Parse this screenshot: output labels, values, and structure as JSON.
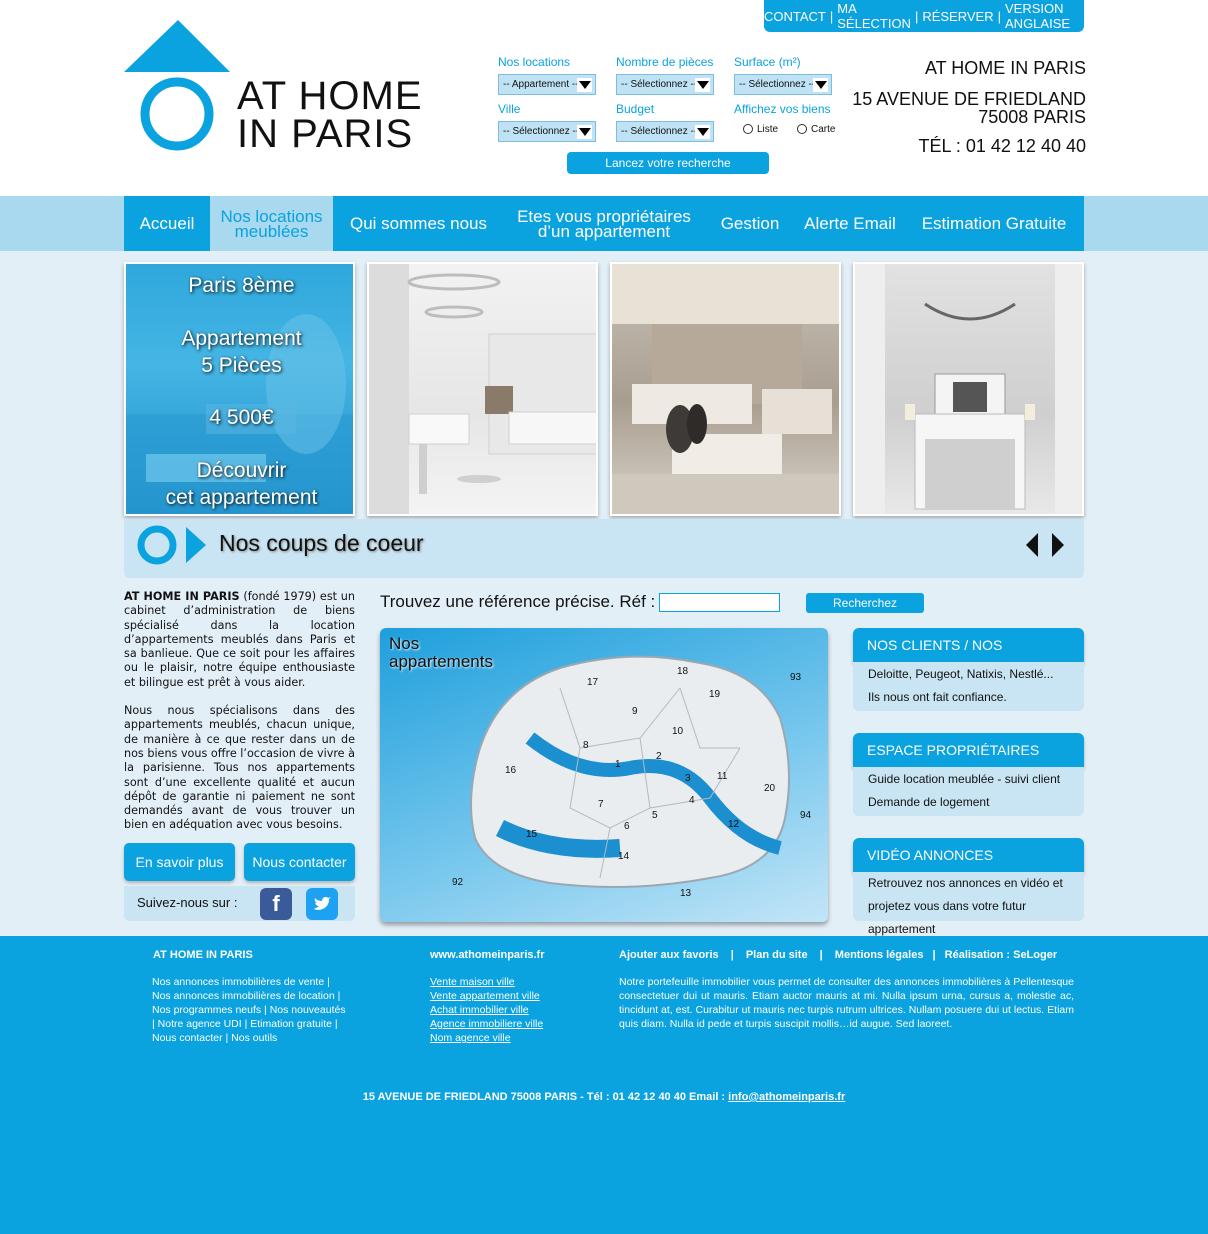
{
  "top_links": [
    "CONTACT",
    "MA SÉLECTION",
    "RÉSERVER",
    "VERSION ANGLAISE"
  ],
  "logo": {
    "line1": "AT HOME",
    "line2": "IN PARIS"
  },
  "search": {
    "nos_locations_label": "Nos locations",
    "nos_locations_value": "-- Appartement --",
    "pieces_label": "Nombre de pièces",
    "pieces_value": "-- Sélectionnez --",
    "surface_label": "Surface (m²)",
    "surface_value": "-- Sélectionnez --",
    "ville_label": "Ville",
    "ville_value": "-- Sélectionnez --",
    "budget_label": "Budget",
    "budget_value": "-- Sélectionnez --",
    "affichez_label": "Affichez vos biens",
    "radio_liste": "Liste",
    "radio_carte": "Carte",
    "launch": "Lancez votre recherche"
  },
  "contact": {
    "name": "AT HOME IN PARIS",
    "address1": "15 AVENUE DE FRIEDLAND",
    "address2": "75008 PARIS",
    "phone": "TÉL : 01 42 12 40 40"
  },
  "nav": [
    {
      "label": "Accueil"
    },
    {
      "label": "Nos locations meublées"
    },
    {
      "label": "Qui sommes nous"
    },
    {
      "label": "Etes vous propriétaires d’un appartement"
    },
    {
      "label": "Gestion"
    },
    {
      "label": "Alerte Email"
    },
    {
      "label": "Estimation Gratuite"
    }
  ],
  "feature": {
    "area": "Paris 8ème",
    "type1": "Appartement",
    "type2": "5 Pièces",
    "price": "4 500€",
    "cta1": "Découvrir",
    "cta2": "cet appartement"
  },
  "coups_de_coeur": "Nos coups de coeur",
  "about": {
    "brand": "AT HOME IN PARIS",
    "p1": " (fondé 1979) est un cabinet d’administration de biens spécialisé dans la location d’appartements meublés dans Paris et sa banlieue. Que ce soit pour les affaires ou le plaisir, notre équipe enthousiaste et bilingue est prêt à vous aider.",
    "p2": "Nous nous spécialisons dans des appartements meublés, chacun unique, de manière à ce que rester dans un de nos biens vous offre l’occasion de vivre à la parisienne. Tous nos appartements sont d’une excellente qualité et aucun dépôt de garantie ni paiement ne sont demandés avant de vous trouver un bien en adéquation avec vous besoins."
  },
  "buttons": {
    "savoir_plus": "En savoir plus",
    "nous_contacter": "Nous contacter",
    "suivez": "Suivez-nous sur :"
  },
  "ref": {
    "label": "Trouvez une référence précise.  Réf :",
    "button": "Recherchez"
  },
  "map": {
    "title1": "Nos",
    "title2": "appartements",
    "arrondissements": [
      "17",
      "18",
      "19",
      "93",
      "8",
      "9",
      "10",
      "16",
      "2",
      "3",
      "11",
      "1",
      "4",
      "20",
      "7",
      "6",
      "5",
      "15",
      "12",
      "94",
      "14",
      "13",
      "92"
    ]
  },
  "panels": {
    "clients": {
      "title": "NOS CLIENTS / NOS PARTENAIRES",
      "lines": [
        "Deloitte, Peugeot, Natixis, Nestlé...",
        "Ils nous ont fait confiance."
      ]
    },
    "proprietaires": {
      "title": "ESPACE PROPRIÉTAIRES",
      "lines": [
        "Guide location meublée - suivi client",
        "Demande de logement"
      ]
    },
    "video": {
      "title": "VIDÉO ANNONCES",
      "lines": [
        "Retrouvez nos annonces en vidéo et",
        "projetez vous dans votre futur appartement"
      ]
    }
  },
  "footer": {
    "col1_title": "AT HOME IN PARIS",
    "col1_lines": [
      "Nos annonces immobilières de vente |",
      "Nos annonces immobilières de location |",
      "Nos programmes neufs | Nos nouveautés",
      "| Notre agence UDI | Etimation gratuite |",
      "Nous contacter | Nos outils"
    ],
    "col2_title": "www.athomeinparis.fr",
    "col2_links": [
      "Vente maison ville",
      "Vente appartement ville",
      "Achat immobilier ville",
      "Agence immobiliere ville",
      "Nom agence ville"
    ],
    "col3_links": [
      "Ajouter aux favoris",
      "Plan du site",
      "Mentions légales",
      "Réalisation : SeLoger"
    ],
    "col3_text": "Notre portefeuille immobilier vous permet de consulter des annonces immobilières à Pellentesque consectetuer dui ut mauris. Etiam auctor mauris at mi. Nulla ipsum urna, cursus a, molestie ac, tincidunt at, est. Curabitur ut mauris nec turpis rutrum ultrices. Nullam posuere dui ut lectus. Etiam quis diam. Nulla id pede et turpis suscipit mollis…id augue. Sed laoreet.",
    "bottom_address": "15 AVENUE DE FRIEDLAND 75008 PARIS  -  Tél : 01 42 12 40 40  Email : ",
    "bottom_email": "info@athomeinparis.fr"
  },
  "colors": {
    "accent": "#0aa2df",
    "light": "#a8d9ef",
    "panel": "#c9e4f2"
  }
}
